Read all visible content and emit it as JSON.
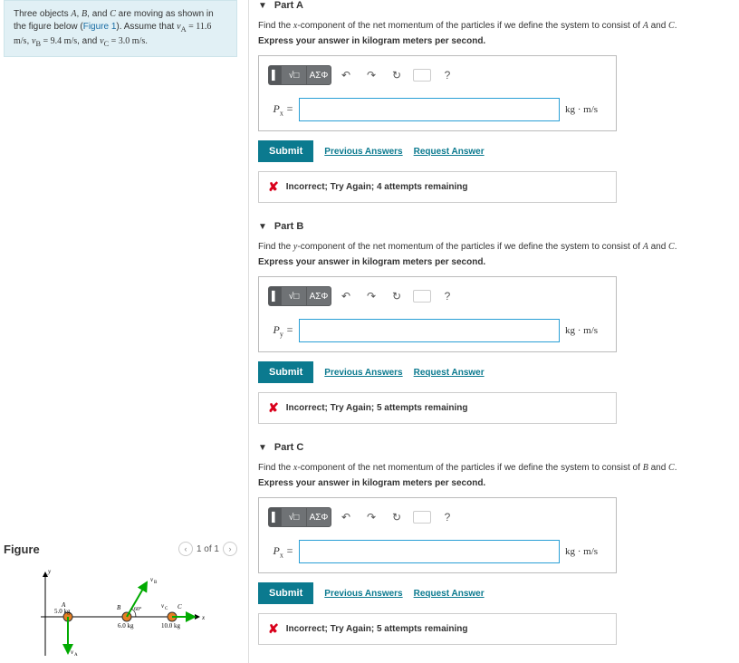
{
  "problem": {
    "text1": "Three objects ",
    "obj": "A, B,",
    "text2": " and ",
    "objC": "C",
    "text3": " are moving as shown in the figure below (",
    "fig_link": "Figure 1",
    "text4": "). Assume that ",
    "vA_lhs": "v_A",
    "vA_val": " = 11.6 m/s",
    "vB_lhs": "v_B",
    "vB_val": " = 9.4 m/s",
    "text5": ", and ",
    "vC_lhs": "v_C",
    "vC_val": " = 3.0 m/s",
    "text6": "."
  },
  "figure": {
    "title": "Figure",
    "pager": "1 of 1",
    "labels": {
      "A": "A",
      "B": "B",
      "C": "C",
      "mA": "5.0 kg",
      "mB": "6.0 kg",
      "mC": "10.0 kg",
      "vA": "v_A",
      "vB": "v_B",
      "vC": "v_C",
      "angle": "60°",
      "x": "x",
      "y": "y"
    }
  },
  "parts": [
    {
      "title": "Part A",
      "prompt_a": "Find the ",
      "prompt_comp": "x",
      "prompt_b": "-component of the net momentum of the particles if we define the system to consist of ",
      "prompt_sys1": "A",
      "prompt_and": " and ",
      "prompt_sys2": "C",
      "prompt_end": ".",
      "instruct": "Express your answer in kilogram meters per second.",
      "lhs": "P_x",
      "unit": "kg · m/s",
      "value": "",
      "submit": "Submit",
      "prev": "Previous Answers",
      "req": "Request Answer",
      "feedback": "Incorrect; Try Again; 4 attempts remaining"
    },
    {
      "title": "Part B",
      "prompt_a": "Find the ",
      "prompt_comp": "y",
      "prompt_b": "-component of the net momentum of the particles if we define the system to consist of ",
      "prompt_sys1": "A",
      "prompt_and": " and ",
      "prompt_sys2": "C",
      "prompt_end": ".",
      "instruct": "Express your answer in kilogram meters per second.",
      "lhs": "P_y",
      "unit": "kg · m/s",
      "value": "",
      "submit": "Submit",
      "prev": "Previous Answers",
      "req": "Request Answer",
      "feedback": "Incorrect; Try Again; 5 attempts remaining"
    },
    {
      "title": "Part C",
      "prompt_a": "Find the ",
      "prompt_comp": "x",
      "prompt_b": "-component of the net momentum of the particles if we define the system to consist of ",
      "prompt_sys1": "B",
      "prompt_and": " and ",
      "prompt_sys2": "C",
      "prompt_end": ".",
      "instruct": "Express your answer in kilogram meters per second.",
      "lhs": "P_x",
      "unit": "kg · m/s",
      "value": "",
      "submit": "Submit",
      "prev": "Previous Answers",
      "req": "Request Answer",
      "feedback": "Incorrect; Try Again; 5 attempts remaining"
    }
  ],
  "toolbar": {
    "sqrt": "√□",
    "greek": "ΑΣΦ",
    "undo": "↶",
    "redo": "↷",
    "reset": "↻",
    "help": "?"
  }
}
